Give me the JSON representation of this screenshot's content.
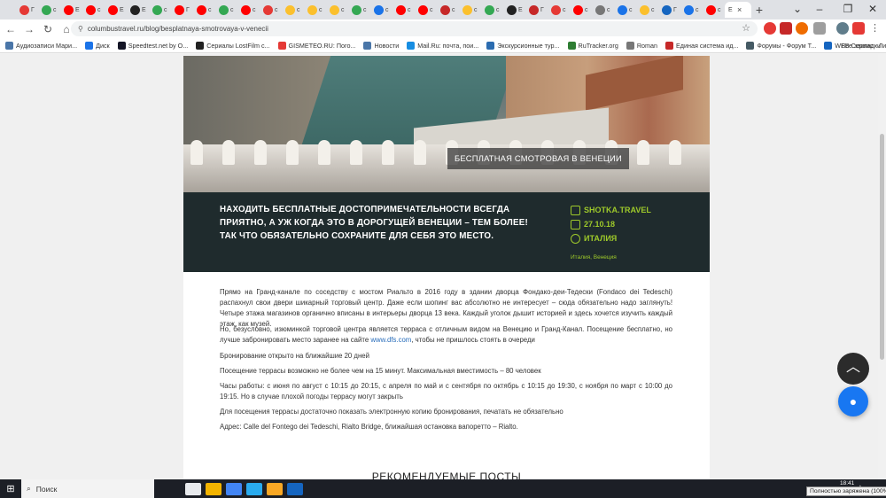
{
  "browser": {
    "tabs": [
      {
        "color": "#e53935",
        "letter": "Г"
      },
      {
        "color": "#34a853",
        "letter": "с"
      },
      {
        "color": "#ff0000",
        "letter": "E"
      },
      {
        "color": "#ff0000",
        "letter": "с"
      },
      {
        "color": "#ff0000",
        "letter": "E"
      },
      {
        "color": "#222222",
        "letter": "E"
      },
      {
        "color": "#34a853",
        "letter": "с"
      },
      {
        "color": "#ff0000",
        "letter": "Г"
      },
      {
        "color": "#ff0000",
        "letter": "с"
      },
      {
        "color": "#34a853",
        "letter": "с"
      },
      {
        "color": "#ff0000",
        "letter": "с"
      },
      {
        "color": "#e53935",
        "letter": "с"
      },
      {
        "color": "#fbc02d",
        "letter": "с"
      },
      {
        "color": "#fbc02d",
        "letter": "с"
      },
      {
        "color": "#fbc02d",
        "letter": "с"
      },
      {
        "color": "#34a853",
        "letter": "с"
      },
      {
        "color": "#1a73e8",
        "letter": "с"
      },
      {
        "color": "#ff0000",
        "letter": "с"
      },
      {
        "color": "#ff0000",
        "letter": "с"
      },
      {
        "color": "#c62828",
        "letter": "с"
      },
      {
        "color": "#fbc02d",
        "letter": "с"
      },
      {
        "color": "#34a853",
        "letter": "с"
      },
      {
        "color": "#222222",
        "letter": "E"
      },
      {
        "color": "#c62828",
        "letter": "Г"
      },
      {
        "color": "#e53935",
        "letter": "с"
      },
      {
        "color": "#ff0000",
        "letter": "с"
      },
      {
        "color": "#777777",
        "letter": "с"
      },
      {
        "color": "#1a73e8",
        "letter": "с"
      },
      {
        "color": "#fbc02d",
        "letter": "с"
      },
      {
        "color": "#1565c0",
        "letter": "Г"
      },
      {
        "color": "#1a73e8",
        "letter": "с"
      },
      {
        "color": "#ff0000",
        "letter": "с"
      }
    ],
    "active_tab_letter": "E",
    "close_glyph": "×",
    "newtab_glyph": "+",
    "url": "columbustravel.ru/blog/besplatnaya-smotrovaya-v-venecii"
  },
  "bookmarks": [
    {
      "label": "Аудиозаписи Мари...",
      "color": "#4a76a8"
    },
    {
      "label": "Диск",
      "color": "#1a73e8"
    },
    {
      "label": "Speedtest.net by O...",
      "color": "#141526"
    },
    {
      "label": "Сериалы LostFilm с...",
      "color": "#222222"
    },
    {
      "label": "GISMETEO.RU: Пого...",
      "color": "#e53935"
    },
    {
      "label": "Новости",
      "color": "#4a76a8"
    },
    {
      "label": "Mail.Ru: почта, пои...",
      "color": "#168de2"
    },
    {
      "label": "Экскурсионные тур...",
      "color": "#2b6cb0"
    },
    {
      "label": "RuTracker.org",
      "color": "#2e7d32"
    },
    {
      "label": "Roman",
      "color": "#777777"
    },
    {
      "label": "Единая система ид...",
      "color": "#c62828"
    },
    {
      "label": "Форумы - Форум T...",
      "color": "#455a64"
    },
    {
      "label": "WEB Сервис - Личн...",
      "color": "#1565c0"
    }
  ],
  "bookmarks_all": "Все закладки",
  "hero": {
    "caption": "БЕСПЛАТНАЯ СМОТРОВАЯ В ВЕНЕЦИИ"
  },
  "infobar": {
    "lead": "НАХОДИТЬ БЕСПЛАТНЫЕ ДОСТОПРИМЕЧАТЕЛЬНОСТИ ВСЕГДА ПРИЯТНО, А УЖ КОГДА ЭТО В ДОРОГУЩЕЙ ВЕНЕЦИИ – ТЕМ БОЛЕЕ! ТАК ЧТО ОБЯЗАТЕЛЬНО СОХРАНИТЕ ДЛЯ СЕБЯ ЭТО МЕСТО.",
    "author": "SHOTKA.TRAVEL",
    "date": "27.10.18",
    "country": "ИТАЛИЯ",
    "tags": "Италия, Венеция"
  },
  "article": {
    "p1": "Прямо на Гранд-канале по соседству с мостом Риальто в 2016 году в здании дворца Фондако-деи-Тедески (Fondaco dei Tedeschi) распахнул свои двери шикарный торговый центр. Даже если шопинг вас абсолютно не интересует – сюда обязательно надо заглянуть! Четыре этажа магазинов органично вписаны в интерьеры дворца 13 века. Каждый уголок дышит историей и здесь хочется изучить каждый этаж, как музей.",
    "p2_before": "Но, безусловно, изюминкой торговой центра является терраса с отличным видом на Венецию и Гранд-Канал. Посещение бесплатно, но лучше забронировать место заранее на сайте ",
    "p2_link": "www.dfs.com",
    "p2_after": ", чтобы не пришлось стоять в очереди",
    "p3": "Бронирование открыто на ближайшие 20 дней",
    "p4": "Посещение террасы возможно не более чем на 15 минут. Максимальная вместимость – 80 человек",
    "p5": "Часы работы: с июня по август с 10:15 до 20:15, с апреля по май и с сентября по октябрь  с 10:15 до 19:30, с ноября по март с 10:00 до 19:15. Но в случае плохой погоды террасу могут закрыть",
    "p6": "Для посещения террасы достаточно показать электронную копию бронирования, печатать не обязательно",
    "p7": "Адрес: Calle del Fontego dei Tedeschi, Rialto Bridge, ближайшая остановка вапоретто – Rialto.",
    "recommended": "РЕКОМЕНДУЕМЫЕ ПОСТЫ"
  },
  "taskbar": {
    "search_placeholder": "Поиск",
    "battery_tooltip": "Полностью заряжена (100%)",
    "clock": "18:41",
    "apps": [
      "#e8eaed",
      "#f4b400",
      "#4285f4",
      "#2aabee",
      "#f9a825",
      "#1565c0"
    ]
  }
}
